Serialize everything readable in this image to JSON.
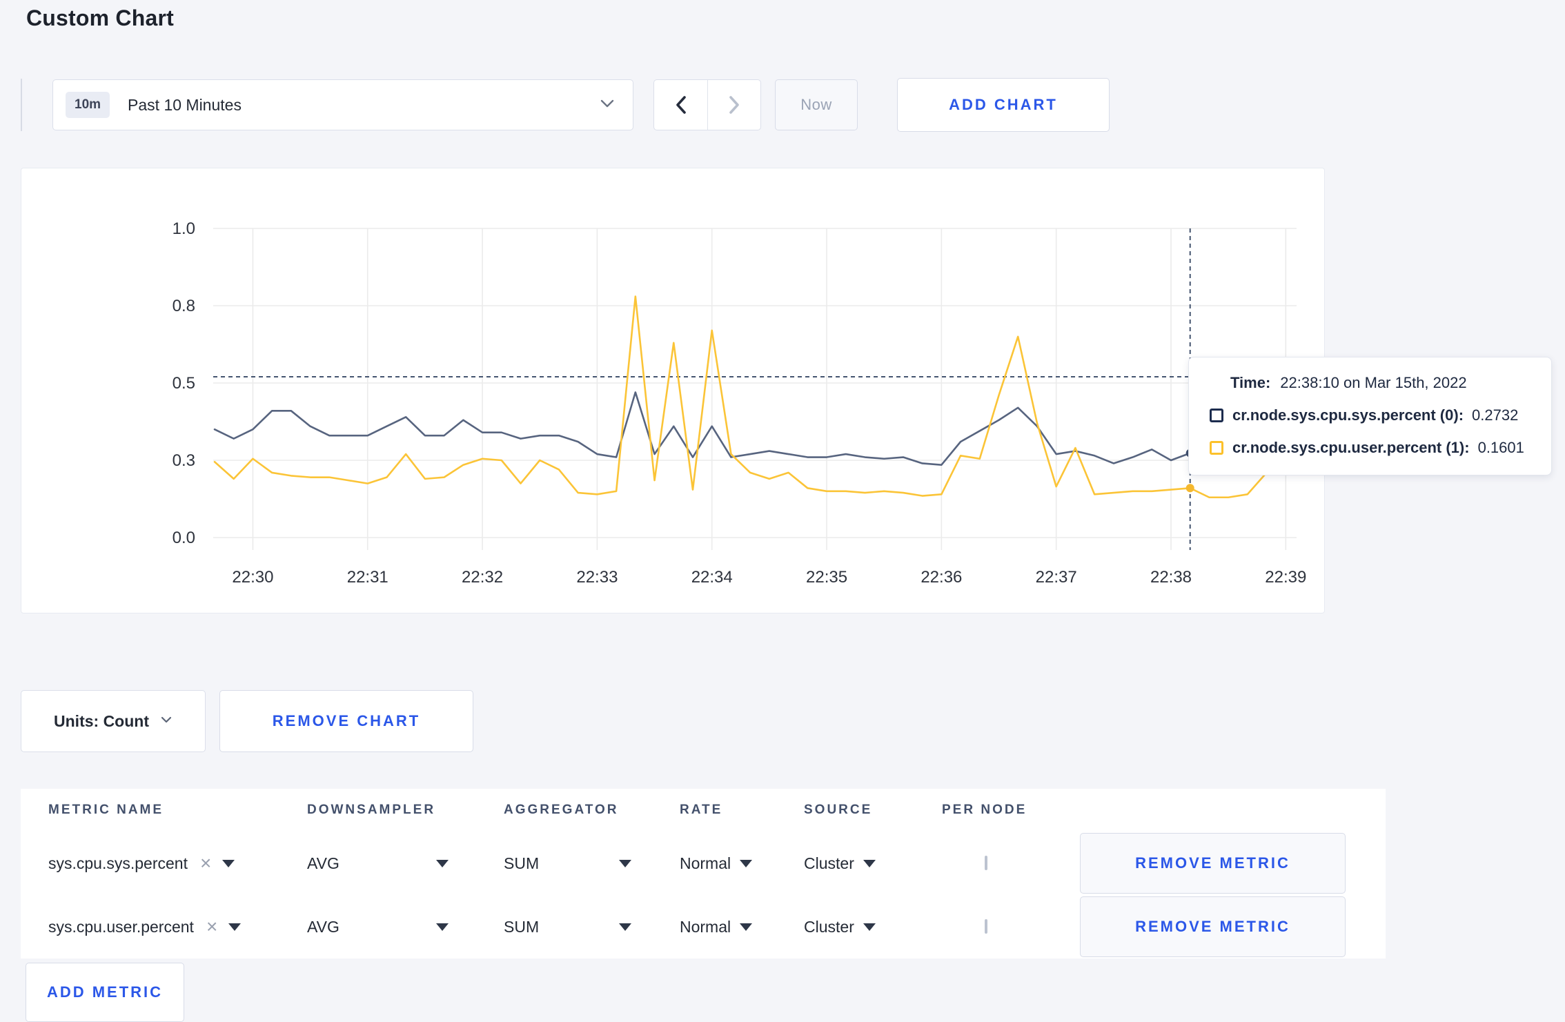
{
  "page": {
    "title": "Custom Chart",
    "background": "#f4f5f9"
  },
  "toolbar": {
    "time_range": {
      "badge": "10m",
      "label": "Past 10 Minutes"
    },
    "now_label": "Now",
    "add_chart_label": "ADD CHART"
  },
  "chart_data": {
    "type": "line",
    "title": "",
    "xlabel": "",
    "ylabel": "",
    "ylim": [
      0,
      1
    ],
    "grid": true,
    "y_ticks": [
      {
        "value": 0,
        "label": "0.0"
      },
      {
        "value": 0.25,
        "label": "0.3"
      },
      {
        "value": 0.5,
        "label": "0.5"
      },
      {
        "value": 0.75,
        "label": "0.8"
      },
      {
        "value": 1,
        "label": "1.0"
      }
    ],
    "x_ticks": [
      {
        "label": "22:30",
        "index": 2
      },
      {
        "label": "22:31",
        "index": 8
      },
      {
        "label": "22:32",
        "index": 14
      },
      {
        "label": "22:33",
        "index": 20
      },
      {
        "label": "22:34",
        "index": 26
      },
      {
        "label": "22:35",
        "index": 32
      },
      {
        "label": "22:36",
        "index": 38
      },
      {
        "label": "22:37",
        "index": 44
      },
      {
        "label": "22:38",
        "index": 50
      },
      {
        "label": "22:39",
        "index": 56
      }
    ],
    "x": [
      "22:29:40",
      "22:29:50",
      "22:30:00",
      "22:30:10",
      "22:30:20",
      "22:30:30",
      "22:30:40",
      "22:30:50",
      "22:31:00",
      "22:31:10",
      "22:31:20",
      "22:31:30",
      "22:31:40",
      "22:31:50",
      "22:32:00",
      "22:32:10",
      "22:32:20",
      "22:32:30",
      "22:32:40",
      "22:32:50",
      "22:33:00",
      "22:33:10",
      "22:33:20",
      "22:33:30",
      "22:33:40",
      "22:33:50",
      "22:34:00",
      "22:34:10",
      "22:34:20",
      "22:34:30",
      "22:34:40",
      "22:34:50",
      "22:35:00",
      "22:35:10",
      "22:35:20",
      "22:35:30",
      "22:35:40",
      "22:35:50",
      "22:36:00",
      "22:36:10",
      "22:36:20",
      "22:36:30",
      "22:36:40",
      "22:36:50",
      "22:37:00",
      "22:37:10",
      "22:37:20",
      "22:37:30",
      "22:37:40",
      "22:37:50",
      "22:38:00",
      "22:38:10",
      "22:38:20",
      "22:38:30",
      "22:38:40",
      "22:38:50",
      "22:39:00",
      "22:39:10"
    ],
    "series": [
      {
        "name": "cr.node.sys.cpu.sys.percent",
        "color": "#57647f",
        "values": [
          0.35,
          0.32,
          0.35,
          0.41,
          0.41,
          0.36,
          0.33,
          0.33,
          0.33,
          0.36,
          0.39,
          0.33,
          0.33,
          0.38,
          0.34,
          0.34,
          0.32,
          0.33,
          0.33,
          0.31,
          0.27,
          0.26,
          0.47,
          0.27,
          0.36,
          0.26,
          0.36,
          0.26,
          0.27,
          0.28,
          0.27,
          0.26,
          0.26,
          0.27,
          0.26,
          0.255,
          0.26,
          0.24,
          0.235,
          0.31,
          0.345,
          0.38,
          0.42,
          0.36,
          0.27,
          0.28,
          0.265,
          0.24,
          0.26,
          0.285,
          0.25,
          0.2732,
          0.26,
          0.26,
          0.255,
          0.26,
          0.265,
          0.255
        ]
      },
      {
        "name": "cr.node.sys.cpu.user.percent",
        "color": "#fbc437",
        "values": [
          0.245,
          0.19,
          0.255,
          0.21,
          0.2,
          0.195,
          0.195,
          0.185,
          0.175,
          0.195,
          0.27,
          0.19,
          0.195,
          0.235,
          0.255,
          0.25,
          0.175,
          0.25,
          0.22,
          0.145,
          0.14,
          0.15,
          0.78,
          0.185,
          0.63,
          0.155,
          0.67,
          0.27,
          0.21,
          0.19,
          0.21,
          0.16,
          0.15,
          0.15,
          0.145,
          0.15,
          0.145,
          0.135,
          0.14,
          0.265,
          0.255,
          0.46,
          0.65,
          0.37,
          0.165,
          0.29,
          0.14,
          0.145,
          0.15,
          0.15,
          0.155,
          0.1601,
          0.13,
          0.13,
          0.14,
          0.21,
          0.275,
          0.23
        ]
      }
    ],
    "crosshair": {
      "time": "22:38:10",
      "guide_value": 0.52
    },
    "legend_position": "tooltip",
    "colors": {
      "grid": "#ebebeb",
      "crosshair": "#44546f",
      "tick_text": "#2e333d"
    }
  },
  "tooltip": {
    "time_label": "Time:",
    "time_value": "22:38:10 on Mar 15th, 2022",
    "series": [
      {
        "name": "cr.node.sys.cpu.sys.percent (0):",
        "value": "0.2732",
        "color": "#1c2c4e"
      },
      {
        "name": "cr.node.sys.cpu.user.percent (1):",
        "value": "0.1601",
        "color": "#fcc12b"
      }
    ]
  },
  "chart_footer": {
    "units_label": "Units: Count",
    "remove_chart_label": "REMOVE CHART"
  },
  "metrics_table": {
    "headers": [
      "METRIC NAME",
      "DOWNSAMPLER",
      "AGGREGATOR",
      "RATE",
      "SOURCE",
      "PER NODE"
    ],
    "rows": [
      {
        "metric_name": "sys.cpu.sys.percent",
        "clear": "×",
        "downsampler": "AVG",
        "aggregator": "SUM",
        "rate": "Normal",
        "source": "Cluster",
        "per_node_checked": false,
        "remove_label": "REMOVE METRIC"
      },
      {
        "metric_name": "sys.cpu.user.percent",
        "clear": "×",
        "downsampler": "AVG",
        "aggregator": "SUM",
        "rate": "Normal",
        "source": "Cluster",
        "per_node_checked": false,
        "remove_label": "REMOVE METRIC"
      }
    ],
    "add_metric_label": "ADD METRIC"
  },
  "accent_color": "#2b57e8"
}
